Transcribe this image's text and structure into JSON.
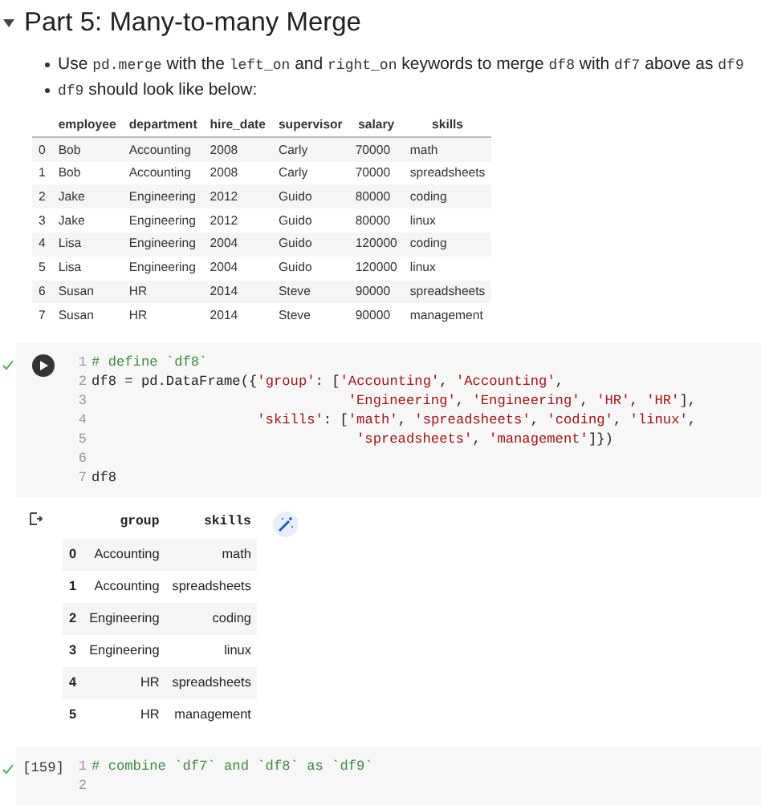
{
  "section": {
    "title": "Part 5: Many-to-many Merge",
    "expanded": true
  },
  "bullets": [
    [
      {
        "kind": "text",
        "text": "Use "
      },
      {
        "kind": "code",
        "text": "pd.merge"
      },
      {
        "kind": "text",
        "text": " with the "
      },
      {
        "kind": "code",
        "text": "left_on"
      },
      {
        "kind": "text",
        "text": " and "
      },
      {
        "kind": "code",
        "text": "right_on"
      },
      {
        "kind": "text",
        "text": " keywords to merge "
      },
      {
        "kind": "code",
        "text": "df8"
      },
      {
        "kind": "text",
        "text": " with "
      },
      {
        "kind": "code",
        "text": "df7"
      },
      {
        "kind": "text",
        "text": " above as "
      },
      {
        "kind": "code",
        "text": "df9"
      }
    ],
    [
      {
        "kind": "code",
        "text": "df9"
      },
      {
        "kind": "text",
        "text": " should look like below:"
      }
    ]
  ],
  "expected_table": {
    "columns": [
      "",
      "employee",
      "department",
      "hire_date",
      "supervisor",
      "salary",
      "skills"
    ],
    "rows": [
      [
        "0",
        "Bob",
        "Accounting",
        "2008",
        "Carly",
        "70000",
        "math"
      ],
      [
        "1",
        "Bob",
        "Accounting",
        "2008",
        "Carly",
        "70000",
        "spreadsheets"
      ],
      [
        "2",
        "Jake",
        "Engineering",
        "2012",
        "Guido",
        "80000",
        "coding"
      ],
      [
        "3",
        "Jake",
        "Engineering",
        "2012",
        "Guido",
        "80000",
        "linux"
      ],
      [
        "4",
        "Lisa",
        "Engineering",
        "2004",
        "Guido",
        "120000",
        "coding"
      ],
      [
        "5",
        "Lisa",
        "Engineering",
        "2004",
        "Guido",
        "120000",
        "linux"
      ],
      [
        "6",
        "Susan",
        "HR",
        "2014",
        "Steve",
        "90000",
        "spreadsheets"
      ],
      [
        "7",
        "Susan",
        "HR",
        "2014",
        "Steve",
        "90000",
        "management"
      ]
    ]
  },
  "cells": [
    {
      "executed": true,
      "lines": [
        {
          "number": "1",
          "tokens": [
            {
              "kind": "comment",
              "text": "# define `df8`"
            }
          ]
        },
        {
          "number": "2",
          "tokens": [
            {
              "kind": "plain",
              "text": "df8 = pd.DataFrame({"
            },
            {
              "kind": "string",
              "text": "'group'"
            },
            {
              "kind": "plain",
              "text": ": ["
            },
            {
              "kind": "string",
              "text": "'Accounting'"
            },
            {
              "kind": "plain",
              "text": ", "
            },
            {
              "kind": "string",
              "text": "'Accounting'"
            },
            {
              "kind": "plain",
              "text": ","
            }
          ]
        },
        {
          "number": "3",
          "kind": "deep",
          "tokens": [
            {
              "kind": "string",
              "text": "'Engineering'"
            },
            {
              "kind": "plain",
              "text": ", "
            },
            {
              "kind": "string",
              "text": "'Engineering'"
            },
            {
              "kind": "plain",
              "text": ", "
            },
            {
              "kind": "string",
              "text": "'HR'"
            },
            {
              "kind": "plain",
              "text": ", "
            },
            {
              "kind": "string",
              "text": "'HR'"
            },
            {
              "kind": "plain",
              "text": "],"
            }
          ]
        },
        {
          "number": "4",
          "kind": "mid",
          "tokens": [
            {
              "kind": "string",
              "text": "'skills'"
            },
            {
              "kind": "plain",
              "text": ": ["
            },
            {
              "kind": "string",
              "text": "'math'"
            },
            {
              "kind": "plain",
              "text": ", "
            },
            {
              "kind": "string",
              "text": "'spreadsheets'"
            },
            {
              "kind": "plain",
              "text": ", "
            },
            {
              "kind": "string",
              "text": "'coding'"
            },
            {
              "kind": "plain",
              "text": ", "
            },
            {
              "kind": "string",
              "text": "'linux'"
            },
            {
              "kind": "plain",
              "text": ","
            }
          ]
        },
        {
          "number": "5",
          "kind": "deeper",
          "tokens": [
            {
              "kind": "string",
              "text": "'spreadsheets'"
            },
            {
              "kind": "plain",
              "text": ", "
            },
            {
              "kind": "string",
              "text": "'management'"
            },
            {
              "kind": "plain",
              "text": "]})"
            }
          ]
        },
        {
          "number": "6"
        },
        {
          "number": "7",
          "tokens": [
            {
              "kind": "plain",
              "text": "df8"
            }
          ]
        }
      ],
      "output": {
        "columns": [
          "",
          "group",
          "skills"
        ],
        "rows": [
          [
            "0",
            "Accounting",
            "math"
          ],
          [
            "1",
            "Accounting",
            "spreadsheets"
          ],
          [
            "2",
            "Engineering",
            "coding"
          ],
          [
            "3",
            "Engineering",
            "linux"
          ],
          [
            "4",
            "HR",
            "spreadsheets"
          ],
          [
            "5",
            "HR",
            "management"
          ]
        ]
      }
    },
    {
      "execution": "[159]",
      "executed": true,
      "lines": [
        {
          "number": "1",
          "tokens": [
            {
              "kind": "comment",
              "text": "# combine `df7` and `df8` as `df9`"
            }
          ]
        },
        {
          "number": "2"
        }
      ]
    }
  ]
}
